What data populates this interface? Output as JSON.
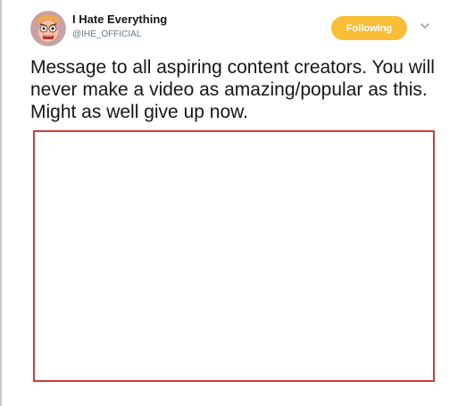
{
  "author": {
    "display_name": "I Hate Everything",
    "handle": "@IHE_OFFICIAL",
    "avatar_icon": "cartoon-face-avatar-icon"
  },
  "follow": {
    "label": "Following",
    "color": "#f9be35"
  },
  "menu": {
    "icon": "chevron-down-icon"
  },
  "tweet": {
    "text": "Message to all aspiring content creators. You will never make a video as amazing/popular as this. Might as well give up now."
  },
  "media": {
    "border_color": "#d13b3b"
  }
}
